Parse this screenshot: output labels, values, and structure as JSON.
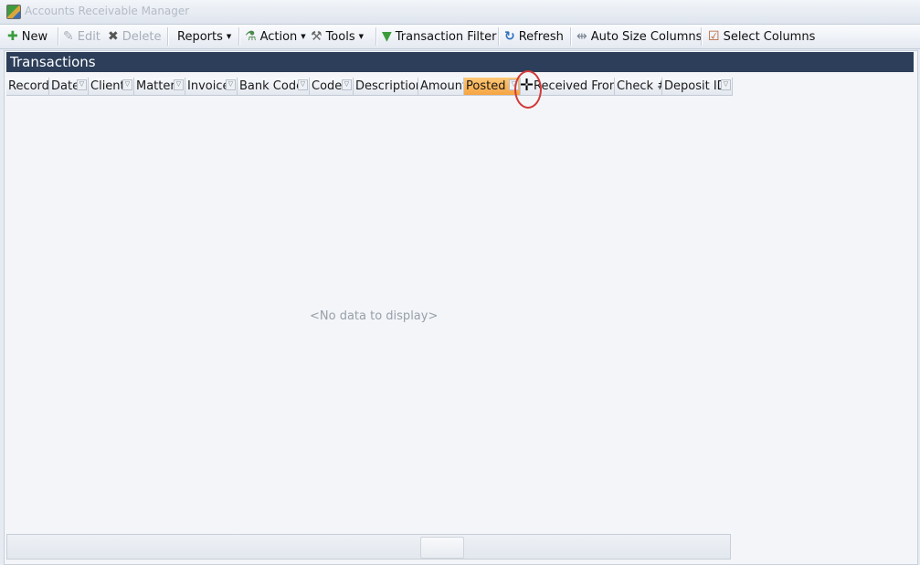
{
  "window": {
    "title": "Accounts Receivable Manager"
  },
  "toolbar": {
    "new_label": "New",
    "edit_label": "Edit",
    "delete_label": "Delete",
    "reports_label": "Reports",
    "action_label": "Action",
    "tools_label": "Tools",
    "transaction_filter_label": "Transaction Filter",
    "refresh_label": "Refresh",
    "auto_size_label": "Auto Size Columns",
    "select_columns_label": "Select Columns"
  },
  "panel": {
    "title": "Transactions"
  },
  "grid": {
    "columns": [
      {
        "label": "Record"
      },
      {
        "label": "Date"
      },
      {
        "label": "Client"
      },
      {
        "label": "Matter"
      },
      {
        "label": "Invoice"
      },
      {
        "label": "Bank Code"
      },
      {
        "label": "Code"
      },
      {
        "label": "Description"
      },
      {
        "label": "Amount"
      },
      {
        "label": "Posted"
      },
      {
        "label": "Received From"
      },
      {
        "label": "Check #"
      },
      {
        "label": "Deposit ID"
      }
    ],
    "empty_text": "<No data to display>"
  },
  "colors": {
    "header_bg": "#2c3e59",
    "active_column": "#f5a544",
    "annotation_circle": "#d33a3a"
  }
}
